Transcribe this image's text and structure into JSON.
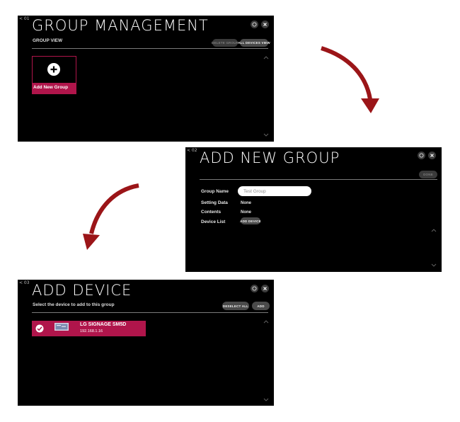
{
  "screen1": {
    "tag": "< 01",
    "title": "GROUP MANAGEMENT",
    "subtitle": "GROUP VIEW",
    "delete_label": "DELETE GROUP",
    "all_devices_label": "ALL DEVICES VIEW",
    "tile_label": "Add New Group",
    "icons": [
      "refresh-icon",
      "close-icon",
      "plus-circle-icon",
      "chevron-up-icon",
      "chevron-down-icon"
    ]
  },
  "screen2": {
    "tag": "< 02",
    "title": "ADD NEW GROUP",
    "done_label": "DONE",
    "fields": {
      "group_name_label": "Group Name",
      "group_name_value": "Test Group",
      "setting_data_label": "Setting Data",
      "setting_data_value": "None",
      "contents_label": "Contents",
      "contents_value": "None",
      "device_list_label": "Device List",
      "add_device_label": "ADD DEVICE"
    }
  },
  "screen3": {
    "tag": "< 03",
    "title": "ADD DEVICE",
    "subtitle": "Select the device to add to this group",
    "deselect_label": "DESELECT ALL",
    "add_label": "ADD",
    "device": {
      "name": "LG SIGNAGE SM5D",
      "ip": "192.168.1.16"
    }
  },
  "colors": {
    "accent": "#b0154b",
    "arrow": "#9b1518",
    "screen_bg": "#000000"
  }
}
